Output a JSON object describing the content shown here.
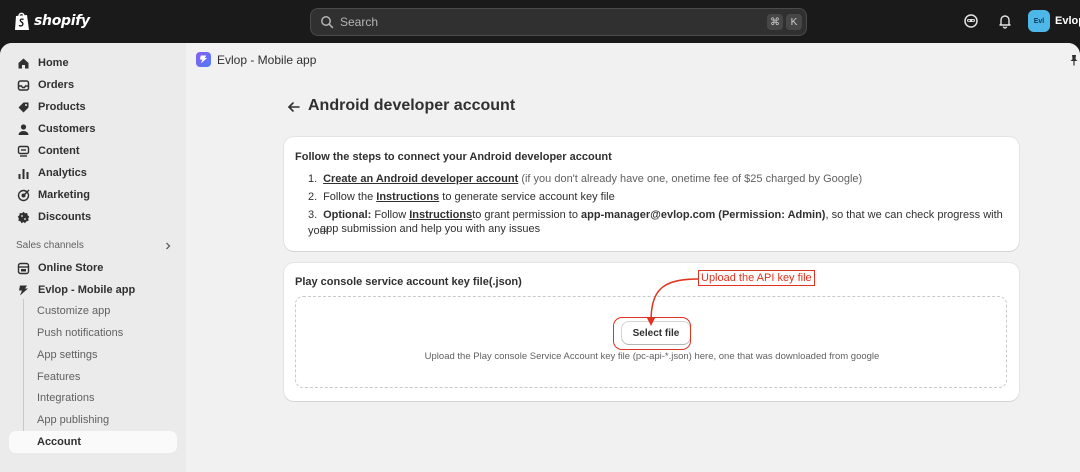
{
  "topbar": {
    "brand": "shopify",
    "search_placeholder": "Search",
    "shortcut_keys": [
      "⌘",
      "K"
    ],
    "store_initials": "Evl",
    "store_name": "Evlop - "
  },
  "sidebar": {
    "items": [
      {
        "label": "Home",
        "icon": "home-icon"
      },
      {
        "label": "Orders",
        "icon": "orders-icon"
      },
      {
        "label": "Products",
        "icon": "tag-icon"
      },
      {
        "label": "Customers",
        "icon": "person-icon"
      },
      {
        "label": "Content",
        "icon": "content-icon"
      },
      {
        "label": "Analytics",
        "icon": "bar-chart-icon"
      },
      {
        "label": "Marketing",
        "icon": "target-icon"
      },
      {
        "label": "Discounts",
        "icon": "discount-icon"
      }
    ],
    "sales_channels_label": "Sales channels",
    "channels": [
      {
        "label": "Online Store",
        "icon": "store-icon"
      },
      {
        "label": "Evlop - Mobile app",
        "icon": "evlop-icon"
      }
    ],
    "sub_items": [
      "Customize app",
      "Push notifications",
      "App settings",
      "Features",
      "Integrations",
      "App publishing",
      "Account"
    ]
  },
  "app_header": {
    "title": "Evlop - Mobile app"
  },
  "page": {
    "title": "Android developer account"
  },
  "steps_card": {
    "heading": "Follow the steps to connect your Android developer account",
    "step1_num": "1.",
    "step1_link": "Create an Android developer account",
    "step1_note": " (if you don't already have one, onetime fee of $25 charged by Google)",
    "step2_num": "2.",
    "step2_pre": "Follow the ",
    "step2_link": "Instructions",
    "step2_post": " to generate service account key file",
    "step3_num": "3.",
    "step3_label": "Optional:",
    "step3_pre": " Follow ",
    "step3_link": "Instructions",
    "step3_mid": "to grant permission to ",
    "step3_email": "app-manager@evlop.com (Permission: Admin)",
    "step3_post": ", so that we can check progress with your",
    "step3_cont": "app submission and help you with any issues"
  },
  "upload_card": {
    "heading": "Play console service account key file(.json)",
    "button_label": "Select file",
    "hint": "Upload the Play console Service Account key file (pc-api-*.json) here, one that was downloaded from google"
  },
  "annotation": {
    "label": "Upload the API key file",
    "color": "#e0321f"
  },
  "colors": {
    "topbar_bg": "#1a1a1a",
    "sidebar_bg": "#ebebeb",
    "main_bg": "#f1f1f1",
    "store_avatar": "#4db8e8"
  }
}
